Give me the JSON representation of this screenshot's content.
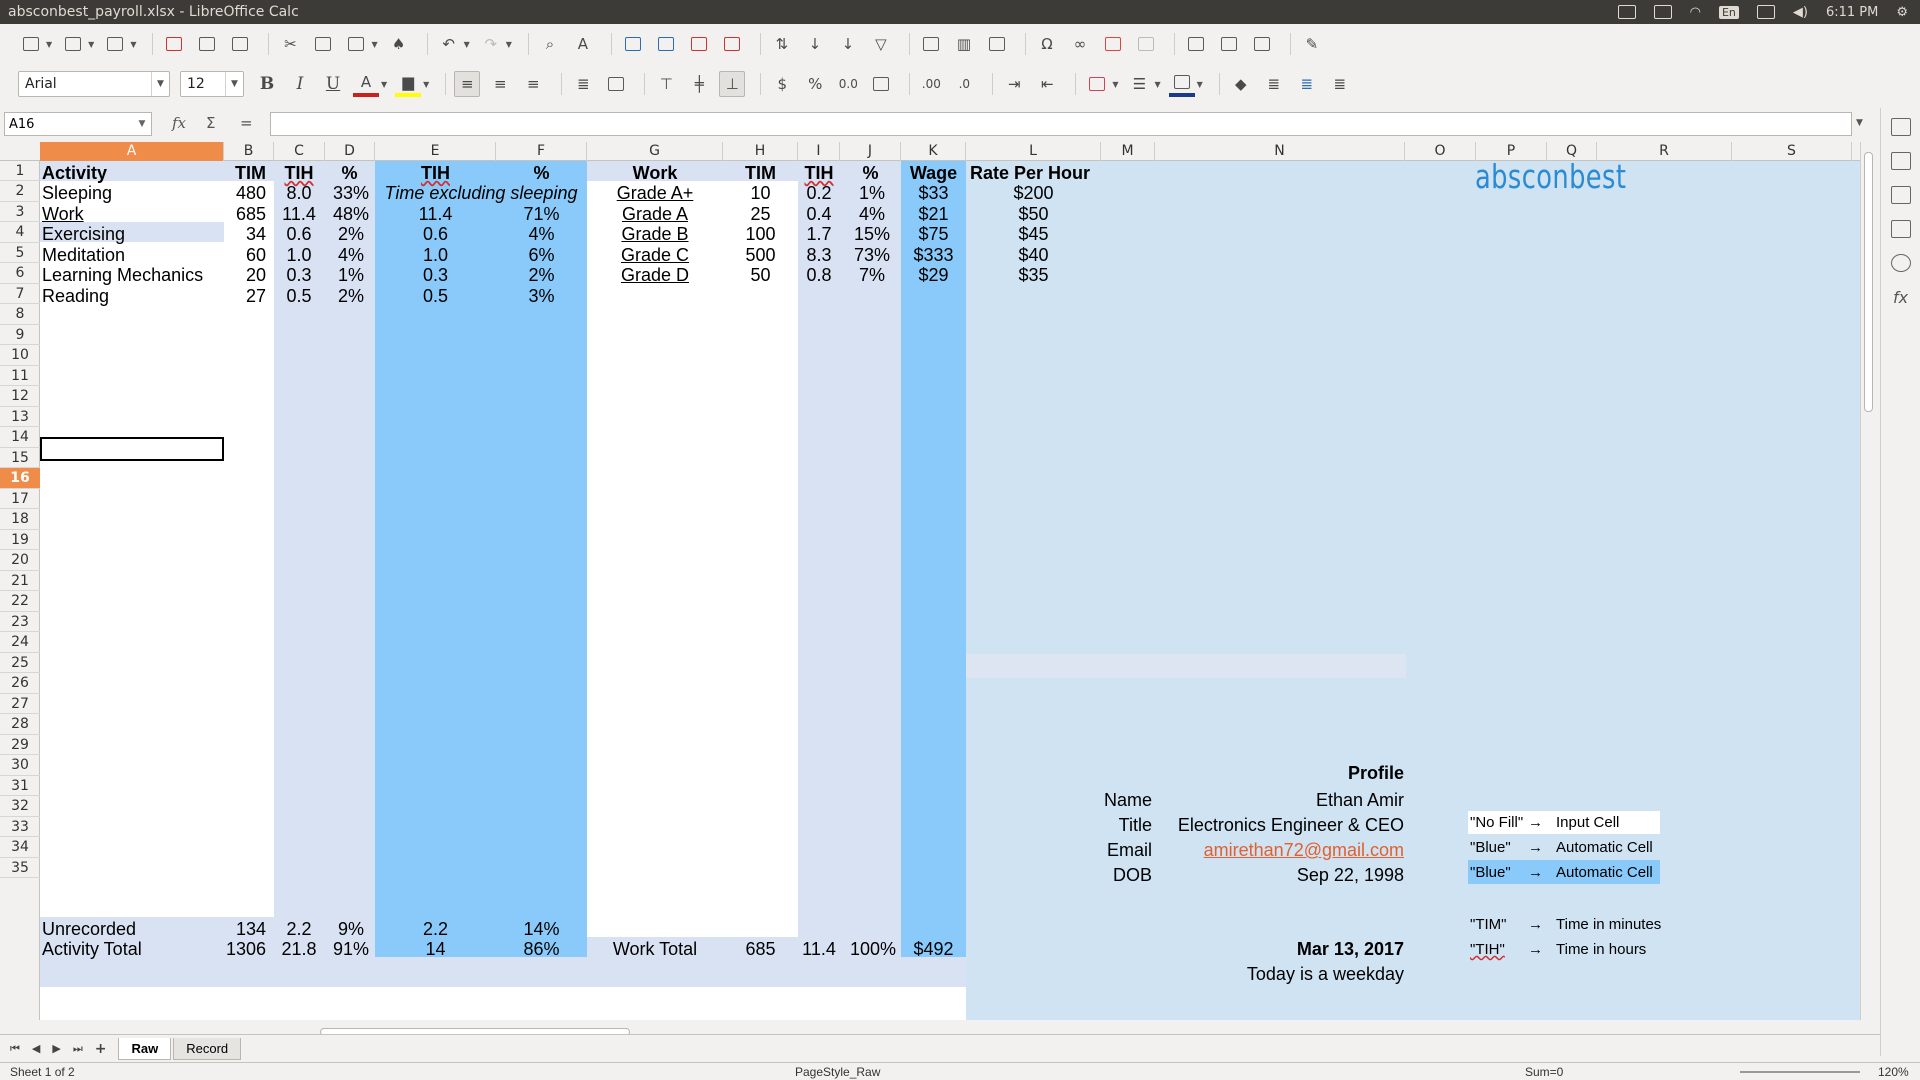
{
  "window": {
    "title": "absconbest_payroll.xlsx - LibreOffice Calc"
  },
  "tray": {
    "lang": "En",
    "time": "6:11 PM"
  },
  "format": {
    "font_name": "Arial",
    "font_size": "12"
  },
  "formula_bar": {
    "cell_ref": "A16",
    "fx": "fx",
    "sum": "Σ",
    "equals": "="
  },
  "columns": [
    "A",
    "B",
    "C",
    "D",
    "E",
    "F",
    "G",
    "H",
    "I",
    "J",
    "K",
    "L",
    "M",
    "N",
    "O",
    "P",
    "Q",
    "R",
    "S"
  ],
  "selected_column": "A",
  "selected_row": 16,
  "colors": {
    "light_blue": "#d9e2f3",
    "mid_blue": "#8acafa",
    "sky": "#cfe3f3",
    "selection": "#f08c4a",
    "email": "#e06030"
  },
  "cells": {
    "header": [
      "Activity",
      "TIM",
      "TIH",
      "%",
      "TIH",
      "%",
      "Work",
      "TIM",
      "TIH",
      "%",
      "Wage",
      "Rate Per Hour"
    ],
    "activities": [
      {
        "name": "Sleeping",
        "tim": "480",
        "tih": "8.0",
        "pct": "33%"
      },
      {
        "name": "Work",
        "tim": "685",
        "tih": "11.4",
        "pct": "48%"
      },
      {
        "name": "Exercising",
        "tim": "34",
        "tih": "0.6",
        "pct": "2%"
      },
      {
        "name": "Meditation",
        "tim": "60",
        "tih": "1.0",
        "pct": "4%"
      },
      {
        "name": "Learning Mechanics",
        "tim": "20",
        "tih": "0.3",
        "pct": "1%"
      },
      {
        "name": "Reading",
        "tim": "27",
        "tih": "0.5",
        "pct": "2%"
      }
    ],
    "excl_note": "Time excluding sleeping",
    "excl": [
      {
        "tih": "11.4",
        "pct": "71%"
      },
      {
        "tih": "0.6",
        "pct": "4%"
      },
      {
        "tih": "1.0",
        "pct": "6%"
      },
      {
        "tih": "0.3",
        "pct": "2%"
      },
      {
        "tih": "0.5",
        "pct": "3%"
      }
    ],
    "grades": [
      {
        "name": "Grade A+",
        "tim": "10",
        "tih": "0.2",
        "pct": "1%",
        "wage": "$33",
        "rate": "$200"
      },
      {
        "name": "Grade A",
        "tim": "25",
        "tih": "0.4",
        "pct": "4%",
        "wage": "$21",
        "rate": "$50"
      },
      {
        "name": "Grade B",
        "tim": "100",
        "tih": "1.7",
        "pct": "15%",
        "wage": "$75",
        "rate": "$45"
      },
      {
        "name": "Grade C",
        "tim": "500",
        "tih": "8.3",
        "pct": "73%",
        "wage": "$333",
        "rate": "$40"
      },
      {
        "name": "Grade D",
        "tim": "50",
        "tih": "0.8",
        "pct": "7%",
        "wage": "$29",
        "rate": "$35"
      }
    ],
    "unrecorded": {
      "label": "Unrecorded",
      "tim": "134",
      "tih": "2.2",
      "pct": "9%",
      "e": "2.2",
      "f": "14%"
    },
    "activity_total": {
      "label": "Activity Total",
      "tim": "1306",
      "tih": "21.8",
      "pct": "91%",
      "e": "14",
      "f": "86%"
    },
    "work_total": {
      "label": "Work Total",
      "tim": "685",
      "tih": "11.4",
      "pct": "100%",
      "wage": "$492"
    },
    "logo": "absconbest",
    "profile": {
      "heading": "Profile",
      "name_label": "Name",
      "name": "Ethan Amir",
      "title_label": "Title",
      "title": "Electronics Engineer & CEO",
      "email_label": "Email",
      "email": "amirethan72@gmail.com",
      "dob_label": "DOB",
      "dob": "Sep 22, 1998"
    },
    "date": "Mar 13, 2017",
    "weekday_note": "Today is a weekday",
    "legend": [
      {
        "key": "\"No Fill\"",
        "arrow": "→",
        "desc": "Input Cell"
      },
      {
        "key": "\"Blue\"",
        "arrow": "→",
        "desc": "Automatic Cell"
      },
      {
        "key": "\"Blue\"",
        "arrow": "→",
        "desc": "Automatic Cell"
      },
      {
        "key": "\"TIM\"",
        "arrow": "→",
        "desc": "Time in minutes"
      },
      {
        "key": "\"TIH\"",
        "arrow": "→",
        "desc": "Time in hours"
      }
    ]
  },
  "sheets": [
    {
      "label": "Raw",
      "active": true
    },
    {
      "label": "Record",
      "active": false
    }
  ],
  "status": {
    "sheet": "Sheet 1 of 2",
    "page_style": "PageStyle_Raw",
    "sum": "Sum=0",
    "zoom": "120%"
  }
}
